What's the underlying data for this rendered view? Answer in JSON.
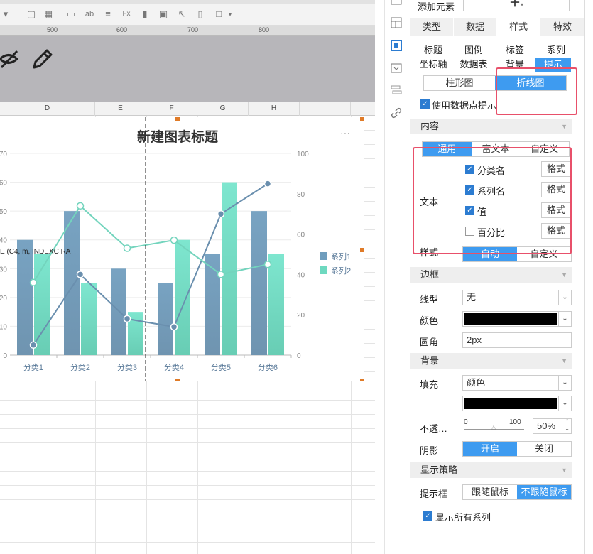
{
  "ruler": {
    "marks": [
      "500",
      "600",
      "700",
      "800"
    ]
  },
  "columns": [
    "D",
    "E",
    "F",
    "G",
    "H",
    "I"
  ],
  "chart": {
    "title": "新建图表标题",
    "more": "···",
    "cell_text": "E (C4, m, INDEXC RA"
  },
  "chart_data": {
    "type": "bar",
    "title": "新建图表标题",
    "categories": [
      "分类1",
      "分类2",
      "分类3",
      "分类4",
      "分类5",
      "分类6"
    ],
    "y_left_ticks": [
      "70",
      "60",
      "50",
      "40",
      "30",
      "20",
      "10",
      "0"
    ],
    "y_right_ticks": [
      "100",
      "80",
      "60",
      "40",
      "20",
      "0"
    ],
    "ylim_left": [
      0,
      70
    ],
    "ylim_right": [
      0,
      100
    ],
    "series": [
      {
        "name": "系列1",
        "bar_values": [
          40,
          50,
          30,
          25,
          35,
          50
        ],
        "line_values": [
          5,
          40,
          18,
          14,
          70,
          85
        ],
        "color": "#6f9dbd"
      },
      {
        "name": "系列2",
        "bar_values": [
          35,
          25,
          15,
          40,
          60,
          35
        ],
        "line_values": [
          36,
          74,
          53,
          57,
          40,
          45
        ],
        "color": "#6ed9c0"
      }
    ],
    "legend_position": "right"
  },
  "panel": {
    "add_element_label": "添加元素",
    "add_button": "＋",
    "main_tabs": [
      "类型",
      "数据",
      "样式",
      "特效"
    ],
    "sub_tabs_row1": [
      "标题",
      "图例",
      "标签",
      "系列"
    ],
    "sub_tabs_row2": [
      "坐标轴",
      "数据表",
      "背景",
      "提示"
    ],
    "chart_types": [
      "柱形图",
      "折线图"
    ],
    "use_point_tip": "使用数据点提示",
    "content_section": "内容",
    "content_modes": [
      "通用",
      "富文本",
      "自定义"
    ],
    "text_label": "文本",
    "text_items": [
      {
        "label": "分类名",
        "checked": true
      },
      {
        "label": "系列名",
        "checked": true
      },
      {
        "label": "值",
        "checked": true
      },
      {
        "label": "百分比",
        "checked": false
      }
    ],
    "format_button": "格式",
    "style_label": "样式",
    "style_modes": [
      "自动",
      "自定义"
    ],
    "border_section": "边框",
    "line_type_label": "线型",
    "line_type_value": "无",
    "color_label": "颜色",
    "radius_label": "圆角",
    "radius_value": "2px",
    "bg_section": "背景",
    "fill_label": "填充",
    "fill_value": "颜色",
    "opacity_label": "不透…",
    "slider_min": "0",
    "slider_max": "100",
    "opacity_value": "50%",
    "opacity_level": 0.5,
    "shadow_label": "阴影",
    "shadow_modes": [
      "开启",
      "关闭"
    ],
    "display_section": "显示策略",
    "tipbox_label": "提示框",
    "tipbox_modes": [
      "跟随鼠标",
      "不跟随鼠标"
    ],
    "show_all_series": "显示所有系列"
  },
  "colors": {
    "accent": "#3e9bf0",
    "highlight": "#e8506a",
    "series1": "#6f9dbd",
    "series2": "#6ed9c0"
  }
}
